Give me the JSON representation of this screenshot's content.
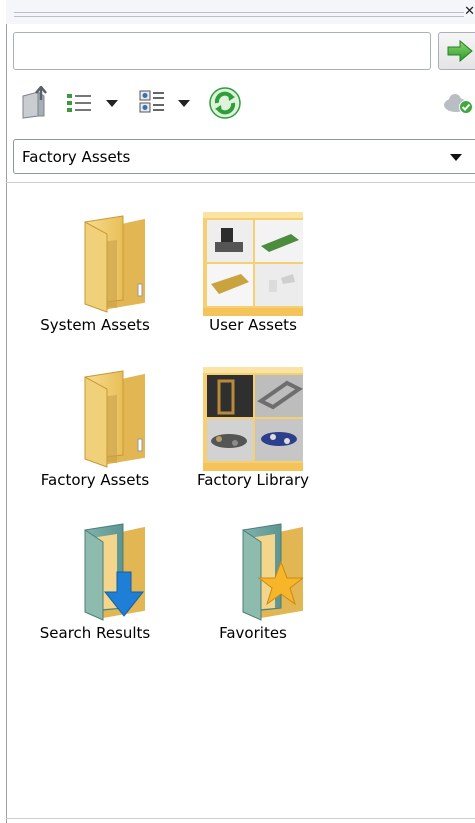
{
  "search": {
    "value": "",
    "placeholder": ""
  },
  "toolbar": {
    "icons": [
      "up-folder-icon",
      "list-view-icon",
      "details-view-icon",
      "refresh-icon",
      "cloud-sync-icon"
    ]
  },
  "location": {
    "selected": "Factory Assets"
  },
  "tiles": [
    {
      "label": "System Assets",
      "icon": "folder-icon"
    },
    {
      "label": "User Assets",
      "icon": "thumbnail-folder-icon"
    },
    {
      "label": "Factory Assets",
      "icon": "folder-icon"
    },
    {
      "label": "Factory Library",
      "icon": "thumbnail-folder-icon"
    },
    {
      "label": "Search Results",
      "icon": "search-folder-icon"
    },
    {
      "label": "Favorites",
      "icon": "favorites-folder-icon"
    }
  ],
  "colors": {
    "folder": "#f2cf73",
    "folder_dark": "#b58f2e",
    "go_green": "#3aa03a",
    "refresh_green": "#2e9e3a",
    "search_arrow": "#1f7fd6",
    "star": "#f7b52a"
  }
}
